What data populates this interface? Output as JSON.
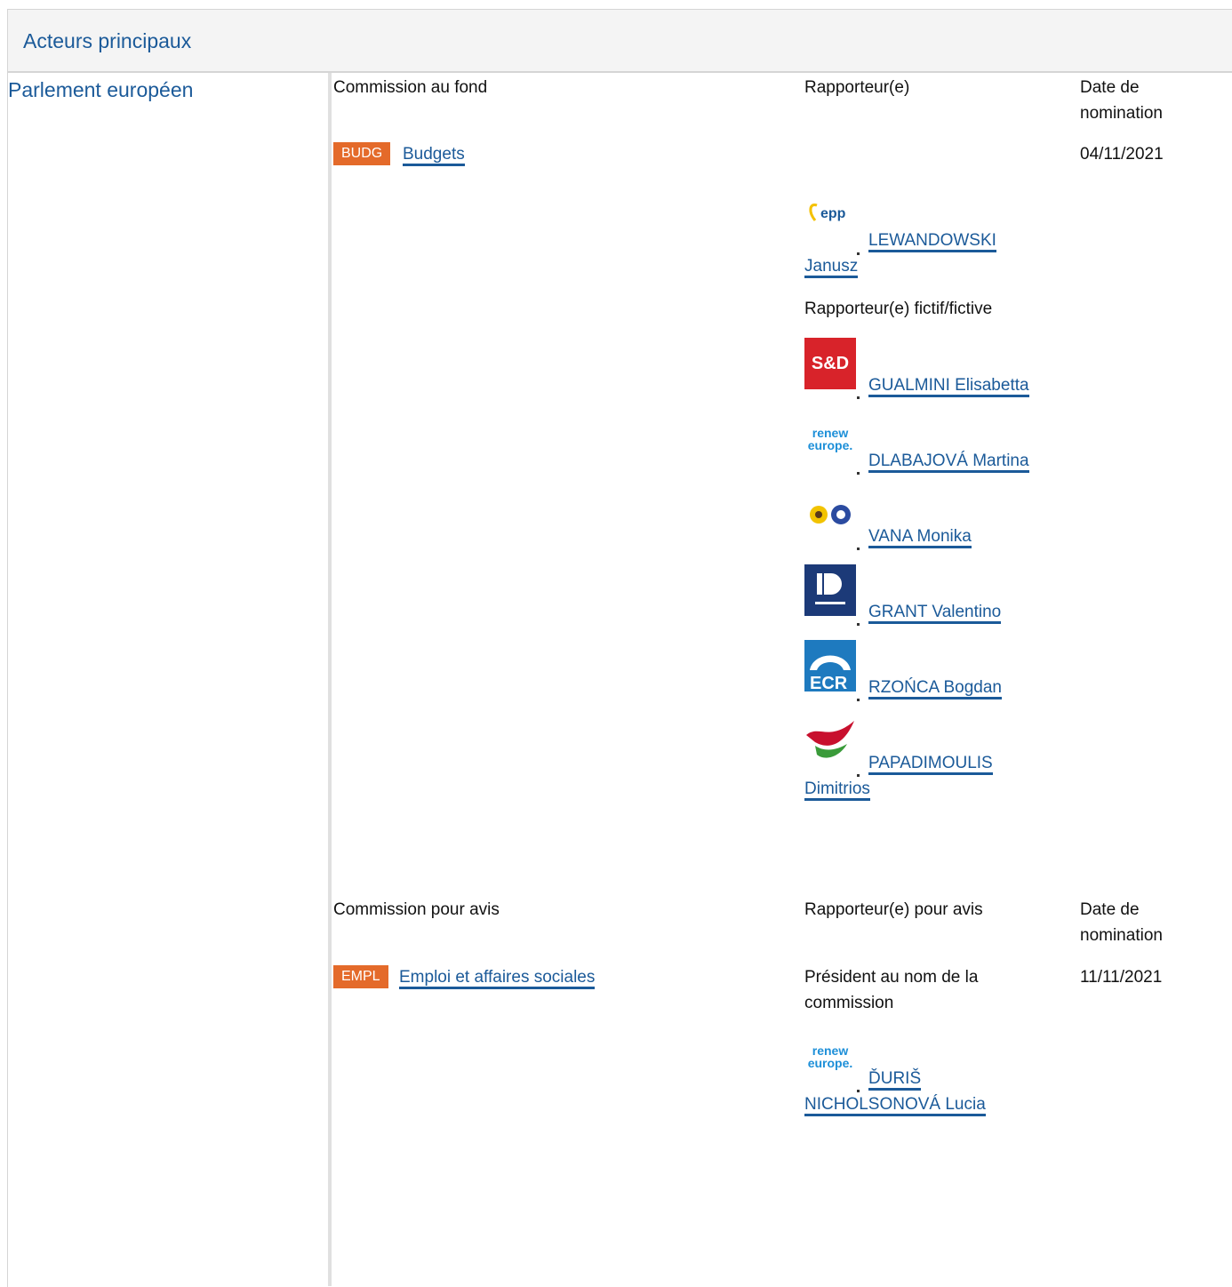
{
  "header": {
    "title": "Acteurs principaux"
  },
  "left_label": "Parlement européen",
  "section1": {
    "col_committee": "Commission au fond",
    "col_rapporteur": "Rapporteur(e)",
    "col_date_line1": "Date de",
    "col_date_line2": "nomination",
    "committee_code": "BUDG",
    "committee_name": "Budgets",
    "date": "04/11/2021",
    "rapporteur": {
      "line1": "LEWANDOWSKI",
      "line2": "Janusz",
      "group_logo": "epp-logo"
    },
    "shadow_label": "Rapporteur(e) fictif/fictive",
    "shadows": [
      {
        "name": "GUALMINI Elisabetta",
        "group_logo": "sd-logo",
        "logo_text": "S&D"
      },
      {
        "name": "DLABAJOVÁ Martina",
        "group_logo": "renew-logo",
        "logo_text": "renew europe."
      },
      {
        "name": "VANA Monika",
        "group_logo": "greens-efa-logo"
      },
      {
        "name": "GRANT Valentino",
        "group_logo": "id-logo"
      },
      {
        "name": "RZOŃCA Bogdan",
        "group_logo": "ecr-logo",
        "logo_text": "ECR"
      },
      {
        "name_line1": "PAPADIMOULIS",
        "name_line2": "Dimitrios",
        "group_logo": "left-logo"
      }
    ]
  },
  "section2": {
    "col_committee": "Commission pour avis",
    "col_rapporteur": "Rapporteur(e) pour avis",
    "col_date_line1": "Date de",
    "col_date_line2": "nomination",
    "committee_code": "EMPL",
    "committee_name": "Emploi et affaires sociales",
    "chair_line1": "Président au nom de la",
    "chair_line2": "commission",
    "date": "11/11/2021",
    "rapporteur": {
      "line1": "ĎURIŠ",
      "line2": "NICHOLSONOVÁ Lucia",
      "group_logo": "renew-logo",
      "logo_text": "renew europe."
    }
  },
  "colors": {
    "link": "#1b5a99",
    "badge": "#e46a2a",
    "header_bg": "#f4f4f4"
  }
}
